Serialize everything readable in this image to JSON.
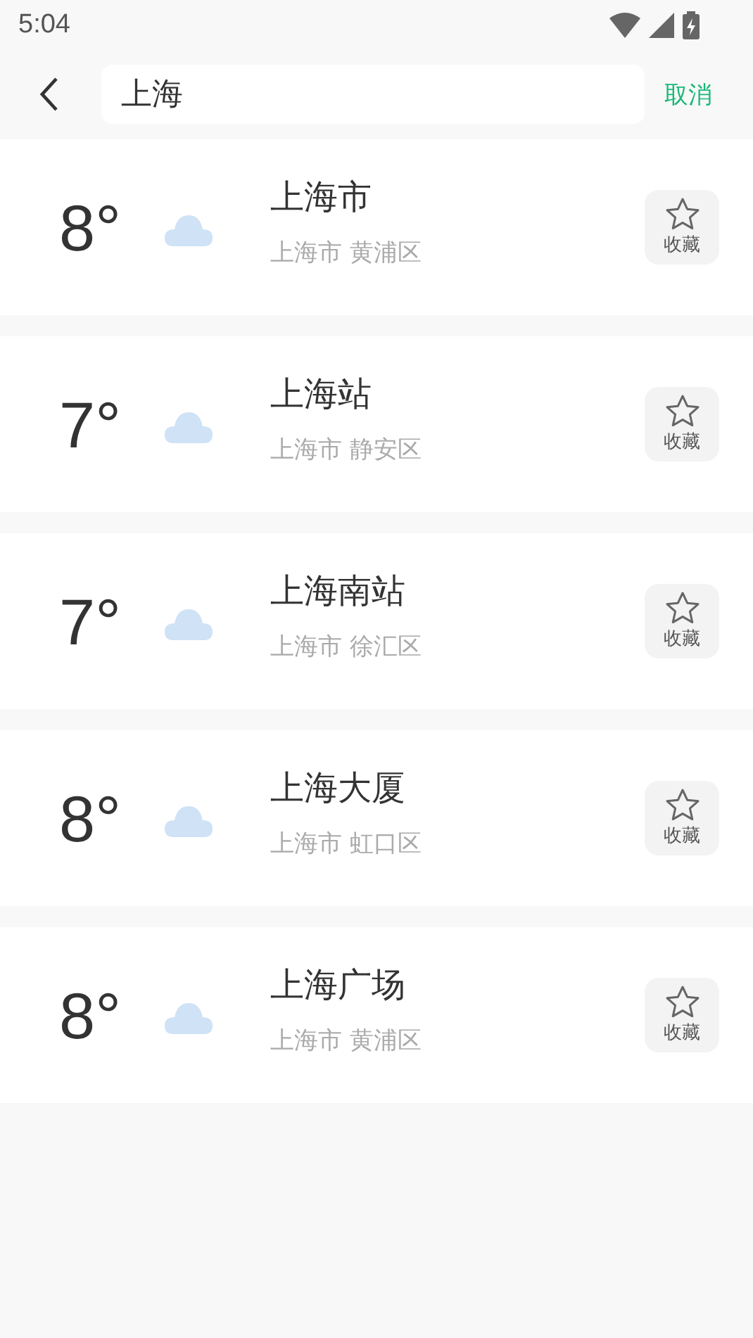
{
  "status_bar": {
    "time": "5:04"
  },
  "search": {
    "value": "上海",
    "cancel": "取消"
  },
  "results": [
    {
      "temp": "8°",
      "name": "上海市",
      "region": "上海市 黄浦区",
      "favorite": "收藏"
    },
    {
      "temp": "7°",
      "name": "上海站",
      "region": "上海市 静安区",
      "favorite": "收藏"
    },
    {
      "temp": "7°",
      "name": "上海南站",
      "region": "上海市 徐汇区",
      "favorite": "收藏"
    },
    {
      "temp": "8°",
      "name": "上海大厦",
      "region": "上海市 虹口区",
      "favorite": "收藏"
    },
    {
      "temp": "8°",
      "name": "上海广场",
      "region": "上海市 黄浦区",
      "favorite": "收藏"
    }
  ]
}
